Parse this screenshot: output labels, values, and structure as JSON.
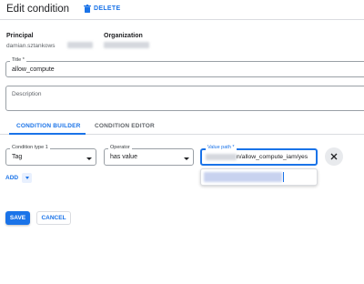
{
  "header": {
    "title": "Edit condition",
    "delete_label": "DELETE"
  },
  "principal": {
    "label": "Principal",
    "value": "damian.sztankows"
  },
  "organization": {
    "label": "Organization"
  },
  "title_field": {
    "label": "Title *",
    "value": "allow_compute"
  },
  "description_field": {
    "placeholder": "Description"
  },
  "tabs": [
    {
      "label": "CONDITION BUILDER",
      "active": true
    },
    {
      "label": "CONDITION EDITOR",
      "active": false
    }
  ],
  "condition": {
    "type_label": "Condition type 1",
    "type_value": "Tag",
    "operator_label": "Operator",
    "operator_value": "has value",
    "value_path_label": "Value path *",
    "value_path_value": "n/allow_compute_iam/yes"
  },
  "add_label": "ADD",
  "actions": {
    "save_label": "SAVE",
    "cancel_label": "CANCEL"
  },
  "colors": {
    "accent": "#1a73e8",
    "border": "#9aa0a6",
    "divider": "#dadce0"
  }
}
